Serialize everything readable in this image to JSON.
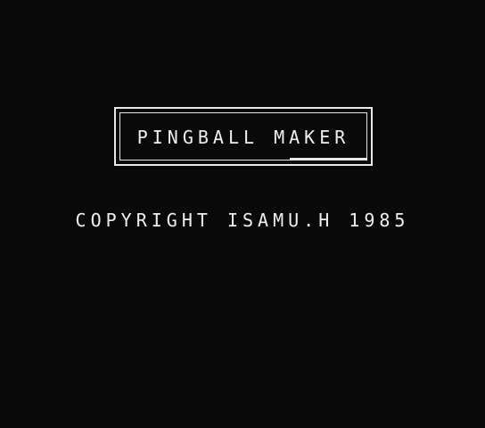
{
  "game": {
    "title": "PINGBALL MAKER",
    "copyright": "COPYRIGHT ISAMU.H 1985"
  },
  "colors": {
    "background": "#0a0a0a",
    "foreground": "#f0f0f0"
  }
}
